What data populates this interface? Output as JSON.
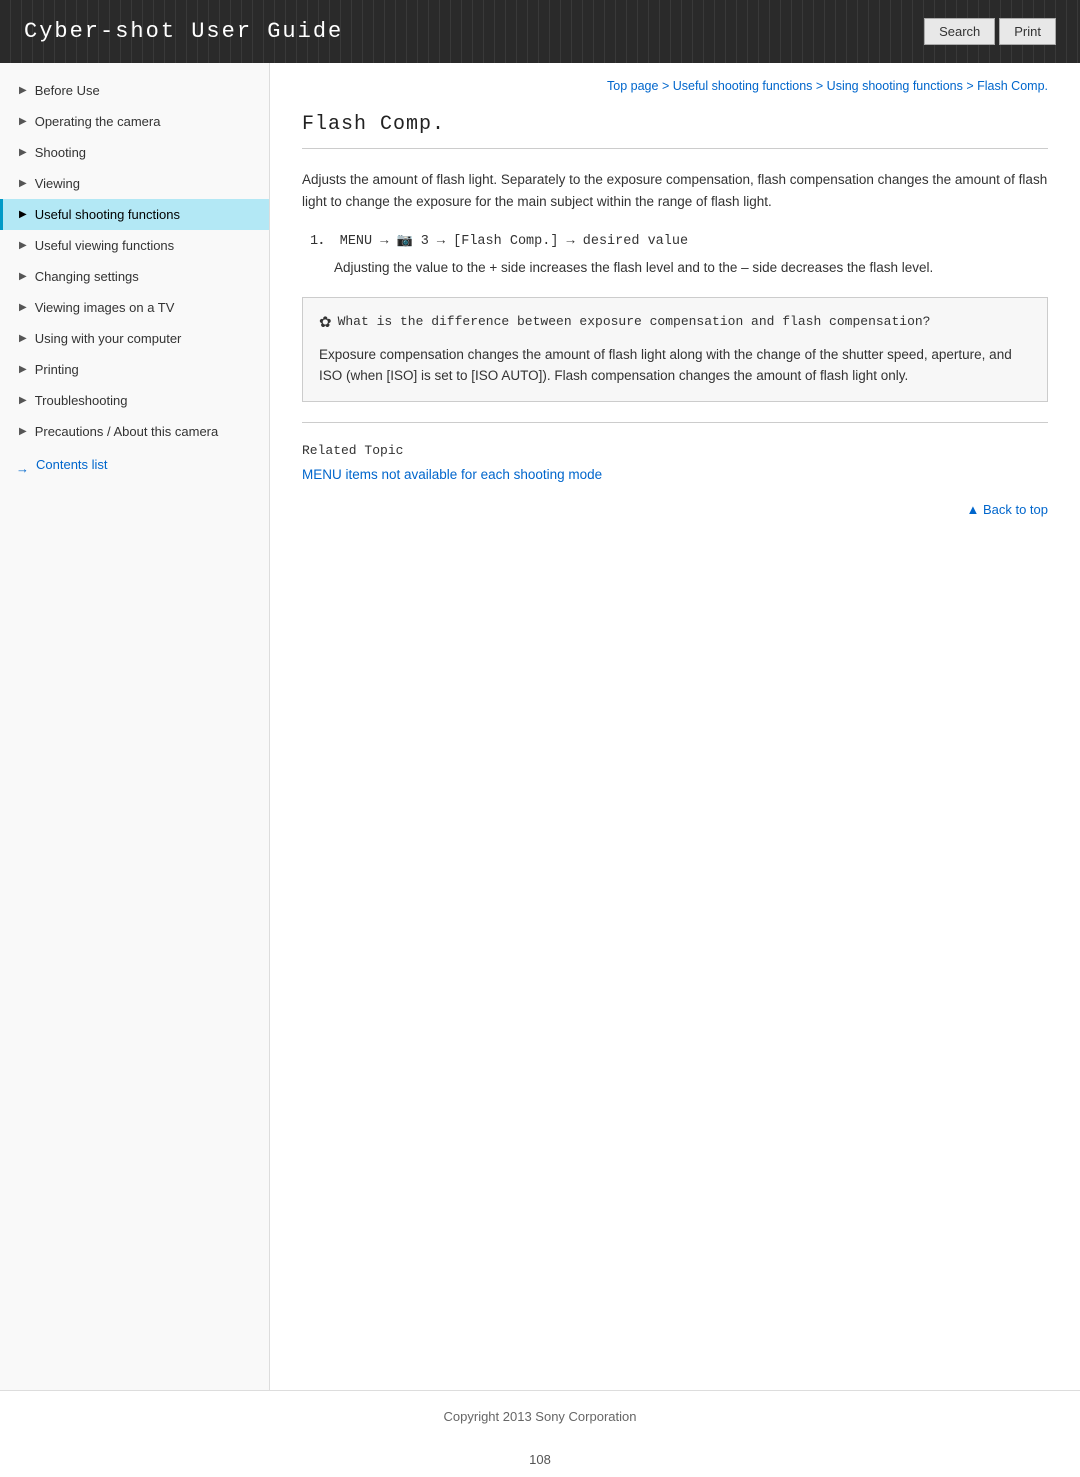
{
  "header": {
    "title": "Cyber-shot User Guide",
    "search_label": "Search",
    "print_label": "Print"
  },
  "breadcrumb": {
    "items": [
      {
        "label": "Top page",
        "href": "#"
      },
      {
        "label": "Useful shooting functions",
        "href": "#"
      },
      {
        "label": "Using shooting functions",
        "href": "#"
      },
      {
        "label": "Flash Comp.",
        "href": "#"
      }
    ],
    "separator": " > "
  },
  "sidebar": {
    "items": [
      {
        "label": "Before Use",
        "active": false
      },
      {
        "label": "Operating the camera",
        "active": false
      },
      {
        "label": "Shooting",
        "active": false
      },
      {
        "label": "Viewing",
        "active": false
      },
      {
        "label": "Useful shooting functions",
        "active": true
      },
      {
        "label": "Useful viewing functions",
        "active": false
      },
      {
        "label": "Changing settings",
        "active": false
      },
      {
        "label": "Viewing images on a TV",
        "active": false
      },
      {
        "label": "Using with your computer",
        "active": false
      },
      {
        "label": "Printing",
        "active": false
      },
      {
        "label": "Troubleshooting",
        "active": false
      },
      {
        "label": "Precautions / About this camera",
        "active": false
      }
    ],
    "contents_link": "Contents list"
  },
  "page": {
    "title": "Flash Comp.",
    "intro": "Adjusts the amount of flash light. Separately to the exposure compensation, flash compensation changes the amount of flash light to change the exposure for the main subject within the range of flash light.",
    "step_label": "1．",
    "step_text": "MENU → 📷 3 → [Flash Comp.] → desired value",
    "step_detail": "Adjusting the value to the + side increases the flash level and to the – side decreases the flash level.",
    "tip_icon": "✿",
    "tip_title": "What is the difference between exposure compensation and flash compensation?",
    "tip_body": "Exposure compensation changes the amount of flash light along with the change of the shutter speed, aperture, and ISO (when [ISO] is set to [ISO AUTO]). Flash compensation changes the amount of flash light only.",
    "related_topic_label": "Related Topic",
    "related_link": "MENU items not available for each shooting mode",
    "back_to_top": "▲ Back to top",
    "page_number": "108",
    "footer_copyright": "Copyright 2013 Sony Corporation"
  }
}
